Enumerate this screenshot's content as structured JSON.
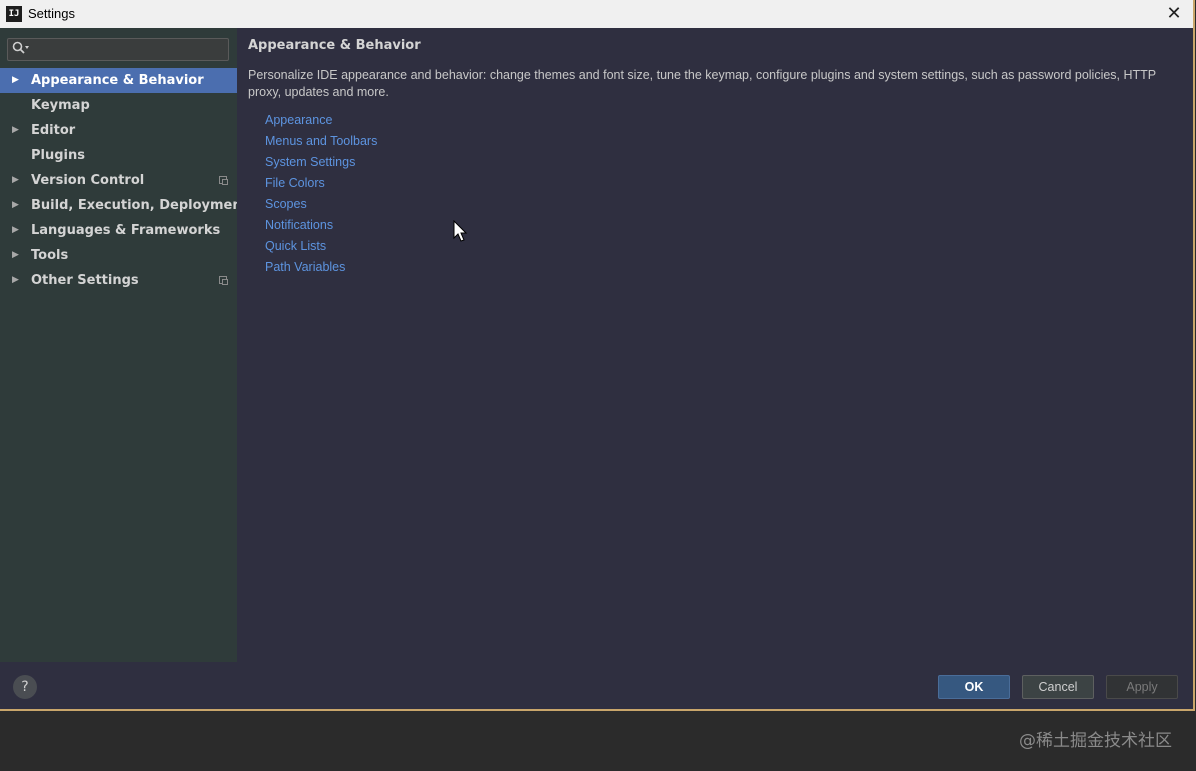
{
  "window": {
    "title": "Settings",
    "app_icon_text": "IJ",
    "close_glyph": "✕"
  },
  "search": {
    "icon": "search-icon",
    "value": "",
    "placeholder": ""
  },
  "sidebar": {
    "items": [
      {
        "label": "Appearance & Behavior",
        "expandable": true,
        "selected": true,
        "badge": false
      },
      {
        "label": "Keymap",
        "expandable": false,
        "selected": false,
        "badge": false
      },
      {
        "label": "Editor",
        "expandable": true,
        "selected": false,
        "badge": false
      },
      {
        "label": "Plugins",
        "expandable": false,
        "selected": false,
        "badge": false
      },
      {
        "label": "Version Control",
        "expandable": true,
        "selected": false,
        "badge": true
      },
      {
        "label": "Build, Execution, Deployment",
        "expandable": true,
        "selected": false,
        "badge": false
      },
      {
        "label": "Languages & Frameworks",
        "expandable": true,
        "selected": false,
        "badge": false
      },
      {
        "label": "Tools",
        "expandable": true,
        "selected": false,
        "badge": false
      },
      {
        "label": "Other Settings",
        "expandable": true,
        "selected": false,
        "badge": true
      }
    ]
  },
  "content": {
    "title": "Appearance & Behavior",
    "description": "Personalize IDE appearance and behavior: change themes and font size, tune the keymap, configure plugins and system settings, such as password policies, HTTP proxy, updates and more.",
    "links": [
      "Appearance",
      "Menus and Toolbars",
      "System Settings",
      "File Colors",
      "Scopes",
      "Notifications",
      "Quick Lists",
      "Path Variables"
    ]
  },
  "footer": {
    "help_label": "?",
    "ok_label": "OK",
    "cancel_label": "Cancel",
    "apply_label": "Apply"
  },
  "watermark": "@稀土掘金技术社区",
  "colors": {
    "selection": "#4b6eaf",
    "link": "#5d94e0",
    "sidebar_bg": "#2f3b3a",
    "content_bg": "#2f2f40"
  }
}
